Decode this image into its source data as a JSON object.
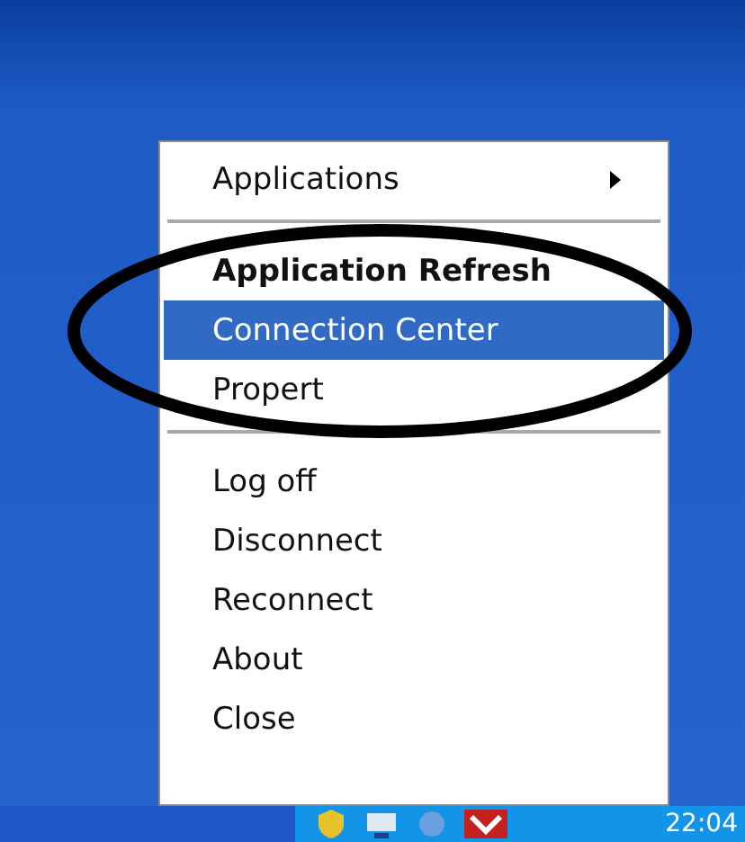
{
  "context_menu": {
    "items": [
      {
        "kind": "item",
        "label": "Applications",
        "selected": false,
        "default": false,
        "submenu": true
      },
      {
        "kind": "separator"
      },
      {
        "kind": "item",
        "label": "Application Refresh",
        "selected": false,
        "default": true,
        "submenu": false
      },
      {
        "kind": "item",
        "label": "Connection Center",
        "selected": true,
        "default": false,
        "submenu": false
      },
      {
        "kind": "item",
        "label": "Propert",
        "selected": false,
        "default": false,
        "submenu": false
      },
      {
        "kind": "separator"
      },
      {
        "kind": "item",
        "label": "Log off",
        "selected": false,
        "default": false,
        "submenu": false
      },
      {
        "kind": "item",
        "label": "Disconnect",
        "selected": false,
        "default": false,
        "submenu": false
      },
      {
        "kind": "item",
        "label": "Reconnect",
        "selected": false,
        "default": false,
        "submenu": false
      },
      {
        "kind": "item",
        "label": "About",
        "selected": false,
        "default": false,
        "submenu": false
      },
      {
        "kind": "item",
        "label": "Close",
        "selected": false,
        "default": false,
        "submenu": false
      }
    ]
  },
  "taskbar": {
    "clock": "22:04"
  }
}
